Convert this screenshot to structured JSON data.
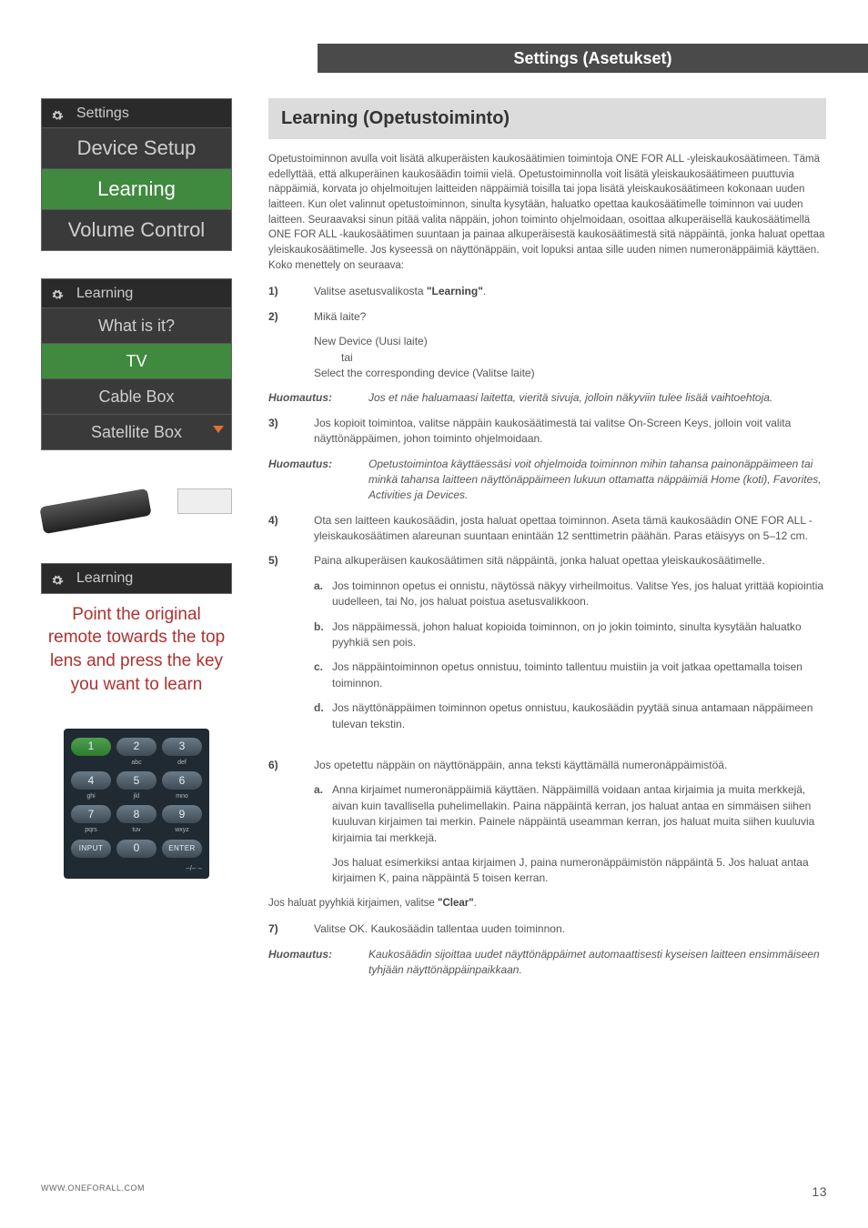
{
  "header": {
    "tab_title": "Settings (Asetukset)"
  },
  "section": {
    "title": "Learning (Opetustoiminto)"
  },
  "intro": "Opetustoiminnon avulla voit lisätä alkuperäisten kaukosäätimien toimintoja ONE FOR ALL -yleiskaukosäätimeen. Tämä edellyttää, että alkuperäinen kaukosäädin toimii vielä. Opetustoiminnolla voit lisätä yleiskaukosäätimeen puuttuvia näppäimiä, korvata jo ohjelmoitujen laitteiden näppäimiä toisilla tai jopa lisätä yleiskaukosäätimeen kokonaan uuden laitteen. Kun olet valinnut opetustoiminnon, sinulta kysytään, haluatko opettaa kaukosäätimelle toiminnon vai uuden laitteen. Seuraavaksi sinun pitää valita näppäin, johon toiminto ohjelmoidaan, osoittaa alkuperäisellä kaukosäätimellä ONE FOR ALL -kaukosäätimen suuntaan ja painaa alkuperäisestä kaukosäätimestä sitä näppäintä, jonka haluat opettaa yleiskaukosäätimelle. Jos kyseessä on näyttönäppäin, voit lopuksi antaa sille uuden nimen numeronäppäimiä käyttäen. Koko menettely on seuraava:",
  "steps": {
    "s1": {
      "num": "1)",
      "text_pre": "Valitse asetusvalikosta ",
      "text_bold": "\"Learning\"",
      "text_post": "."
    },
    "s2": {
      "num": "2)",
      "text": "Mikä laite?"
    },
    "s2_block": {
      "l1": "New Device (Uusi laite)",
      "l2": "tai",
      "l3": "Select the corresponding device (Valitse laite)"
    },
    "note1": {
      "label": "Huomautus",
      "text": "Jos et näe haluamaasi laitetta, vieritä sivuja, jolloin näkyviin tulee lisää vaihtoehtoja."
    },
    "s3": {
      "num": "3)",
      "text": "Jos kopioit toimintoa, valitse näppäin kaukosäätimestä tai valitse On-Screen Keys, jolloin voit valita näyttönäppäimen, johon toiminto ohjelmoidaan."
    },
    "note2": {
      "label": "Huomautus",
      "text": "Opetustoimintoa käyttäessäsi voit ohjelmoida toiminnon mihin tahansa painonäppäimeen tai minkä tahansa laitteen näyttönäppäimeen lukuun ottamatta näppäimiä Home (koti), Favorites, Activities ja Devices."
    },
    "s4": {
      "num": "4)",
      "text": "Ota sen laitteen kaukosäädin, josta haluat opettaa toiminnon. Aseta tämä kaukosäädin ONE FOR ALL -yleiskaukosäätimen alareunan suuntaan enintään 12 senttimetrin päähän. Paras etäisyys on 5–12 cm."
    },
    "s5": {
      "num": "5)",
      "text": "Paina alkuperäisen kaukosäätimen sitä näppäintä, jonka haluat opettaa yleiskaukosäätimelle."
    },
    "s5a": {
      "l": "a.",
      "text": "Jos toiminnon opetus ei onnistu, näytössä näkyy virheilmoitus. Valitse Yes, jos haluat yrittää kopiointia uudelleen, tai No, jos haluat poistua asetusvalikkoon."
    },
    "s5b": {
      "l": "b.",
      "text": "Jos näppäimessä, johon haluat kopioida toiminnon, on jo jokin toiminto, sinulta kysytään haluatko pyyhkiä sen pois."
    },
    "s5c": {
      "l": "c.",
      "text": "Jos näppäintoiminnon opetus onnistuu, toiminto tallentuu muistiin ja voit jatkaa opettamalla toisen toiminnon."
    },
    "s5d": {
      "l": "d.",
      "text": "Jos näyttönäppäimen toiminnon opetus onnistuu, kaukosäädin pyytää sinua antamaan näppäimeen tulevan tekstin."
    },
    "s6": {
      "num": "6)",
      "text": "Jos opetettu näppäin on näyttönäppäin, anna teksti käyttämällä numeronäppäimistöä."
    },
    "s6a": {
      "l": "a.",
      "text": "Anna kirjaimet numeronäppäimiä käyttäen. Näppäimillä voidaan antaa kirjaimia ja muita merkkejä, aivan kuin tavallisella puhelimellakin. Paina näppäintä kerran, jos haluat antaa en simmäisen siihen kuuluvan kirjaimen tai merkin. Painele näppäintä useamman kerran, jos haluat muita siihen kuuluvia kirjaimia tai merkkejä."
    },
    "s6a2": {
      "text": "Jos haluat esimerkiksi antaa kirjaimen J, paina numeronäppäimistön näppäintä 5. Jos haluat antaa kirjaimen K, paina näppäintä 5 toisen kerran."
    },
    "clear_line": {
      "pre": "Jos haluat pyyhkiä kirjaimen, valitse ",
      "bold": "\"Clear\"",
      "post": "."
    },
    "s7": {
      "num": "7)",
      "text": "Valitse OK. Kaukosäädin tallentaa uuden toiminnon."
    },
    "note3": {
      "label": "Huomautus",
      "text": "Kaukosäädin sijoittaa uudet näyttönäppäimet automaattisesti kyseisen laitteen ensimmäiseen tyhjään näyttönäppäinpaikkaan."
    }
  },
  "left": {
    "menu1": {
      "header": "Settings",
      "items": [
        "Device Setup",
        "Learning",
        "Volume Control"
      ],
      "selected_index": 1
    },
    "menu2": {
      "header": "Learning",
      "items": [
        "What is it?",
        "TV",
        "Cable Box",
        "Satellite Box"
      ],
      "selected_index": 1
    },
    "menu3": {
      "header": "Learning",
      "instruction": "Point the original remote towards the top lens and press the key you want to learn"
    }
  },
  "keypad": {
    "rows": [
      {
        "keys": [
          "1",
          "2",
          "3"
        ],
        "subs": [
          "",
          "abc",
          "def"
        ]
      },
      {
        "keys": [
          "4",
          "5",
          "6"
        ],
        "subs": [
          "ghi",
          "jkl",
          "mno"
        ]
      },
      {
        "keys": [
          "7",
          "8",
          "9"
        ],
        "subs": [
          "pqrs",
          "tuv",
          "wxyz"
        ]
      },
      {
        "keys": [
          "INPUT",
          "0",
          "ENTER"
        ],
        "subs": [
          "",
          "",
          ""
        ]
      }
    ],
    "selected": "1",
    "footer": "–/– –"
  },
  "footer": {
    "url": "WWW.ONEFORALL.COM",
    "page": "13"
  }
}
